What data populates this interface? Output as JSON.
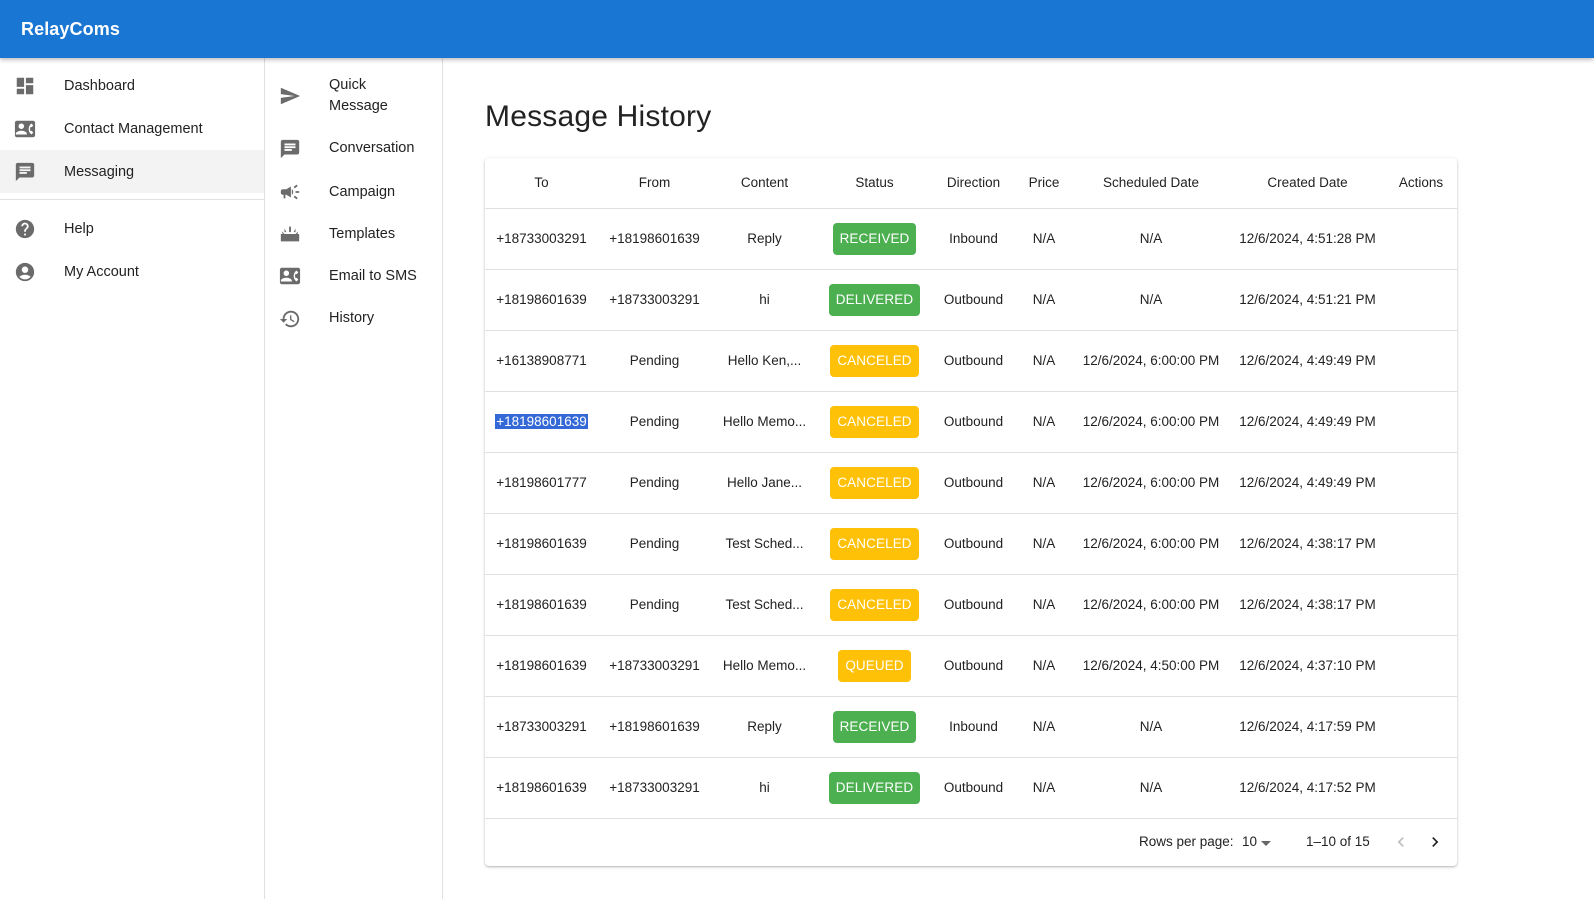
{
  "app": {
    "brand": "RelayComs"
  },
  "sidebar": {
    "items": [
      {
        "label": "Dashboard",
        "icon": "dashboard-icon"
      },
      {
        "label": "Contact Management",
        "icon": "contact-card-icon"
      },
      {
        "label": "Messaging",
        "icon": "chat-icon",
        "selected": true
      }
    ],
    "secondary": [
      {
        "label": "Help",
        "icon": "help-icon"
      },
      {
        "label": "My Account",
        "icon": "account-circle-icon"
      }
    ]
  },
  "subnav": {
    "items": [
      {
        "label_line1": "Quick",
        "label_line2": "Message",
        "icon": "send-icon"
      },
      {
        "label": "Conversation",
        "icon": "chat-icon"
      },
      {
        "label": "Campaign",
        "icon": "campaign-icon"
      },
      {
        "label": "Templates",
        "icon": "templates-icon"
      },
      {
        "label": "Email to SMS",
        "icon": "contact-card-icon"
      },
      {
        "label": "History",
        "icon": "history-icon"
      }
    ]
  },
  "page": {
    "title": "Message History"
  },
  "table": {
    "columns": [
      "To",
      "From",
      "Content",
      "Status",
      "Direction",
      "Price",
      "Scheduled Date",
      "Created Date",
      "Actions"
    ],
    "rows": [
      {
        "to": "+18733003291",
        "from": "+18198601639",
        "content": "Reply",
        "status": "RECEIVED",
        "direction": "Inbound",
        "price": "N/A",
        "scheduled": "N/A",
        "created": "12/6/2024, 4:51:28 PM"
      },
      {
        "to": "+18198601639",
        "from": "+18733003291",
        "content": "hi",
        "status": "DELIVERED",
        "direction": "Outbound",
        "price": "N/A",
        "scheduled": "N/A",
        "created": "12/6/2024, 4:51:21 PM"
      },
      {
        "to": "+16138908771",
        "from": "Pending",
        "content": "Hello Ken,...",
        "status": "CANCELED",
        "direction": "Outbound",
        "price": "N/A",
        "scheduled": "12/6/2024, 6:00:00 PM",
        "created": "12/6/2024, 4:49:49 PM"
      },
      {
        "to": "+18198601639",
        "from": "Pending",
        "content": "Hello Memo...",
        "status": "CANCELED",
        "direction": "Outbound",
        "price": "N/A",
        "scheduled": "12/6/2024, 6:00:00 PM",
        "created": "12/6/2024, 4:49:49 PM"
      },
      {
        "to": "+18198601777",
        "from": "Pending",
        "content": "Hello Jane...",
        "status": "CANCELED",
        "direction": "Outbound",
        "price": "N/A",
        "scheduled": "12/6/2024, 6:00:00 PM",
        "created": "12/6/2024, 4:49:49 PM"
      },
      {
        "to": "+18198601639",
        "from": "Pending",
        "content": "Test Sched...",
        "status": "CANCELED",
        "direction": "Outbound",
        "price": "N/A",
        "scheduled": "12/6/2024, 6:00:00 PM",
        "created": "12/6/2024, 4:38:17 PM"
      },
      {
        "to": "+18198601639",
        "from": "Pending",
        "content": "Test Sched...",
        "status": "CANCELED",
        "direction": "Outbound",
        "price": "N/A",
        "scheduled": "12/6/2024, 6:00:00 PM",
        "created": "12/6/2024, 4:38:17 PM"
      },
      {
        "to": "+18198601639",
        "from": "+18733003291",
        "content": "Hello Memo...",
        "status": "QUEUED",
        "direction": "Outbound",
        "price": "N/A",
        "scheduled": "12/6/2024, 4:50:00 PM",
        "created": "12/6/2024, 4:37:10 PM"
      },
      {
        "to": "+18733003291",
        "from": "+18198601639",
        "content": "Reply",
        "status": "RECEIVED",
        "direction": "Inbound",
        "price": "N/A",
        "scheduled": "N/A",
        "created": "12/6/2024, 4:17:59 PM"
      },
      {
        "to": "+18198601639",
        "from": "+18733003291",
        "content": "hi",
        "status": "DELIVERED",
        "direction": "Outbound",
        "price": "N/A",
        "scheduled": "N/A",
        "created": "12/6/2024, 4:17:52 PM"
      }
    ]
  },
  "status_colors": {
    "RECEIVED": "#4caf50",
    "DELIVERED": "#4caf50",
    "CANCELED": "#ffc107",
    "QUEUED": "#ffc107"
  },
  "pagination": {
    "rows_per_page_label": "Rows per page:",
    "rows_per_page": "10",
    "range": "1–10 of 15"
  },
  "colors": {
    "appbar": "#1976d2",
    "selection": "#3468d6"
  }
}
